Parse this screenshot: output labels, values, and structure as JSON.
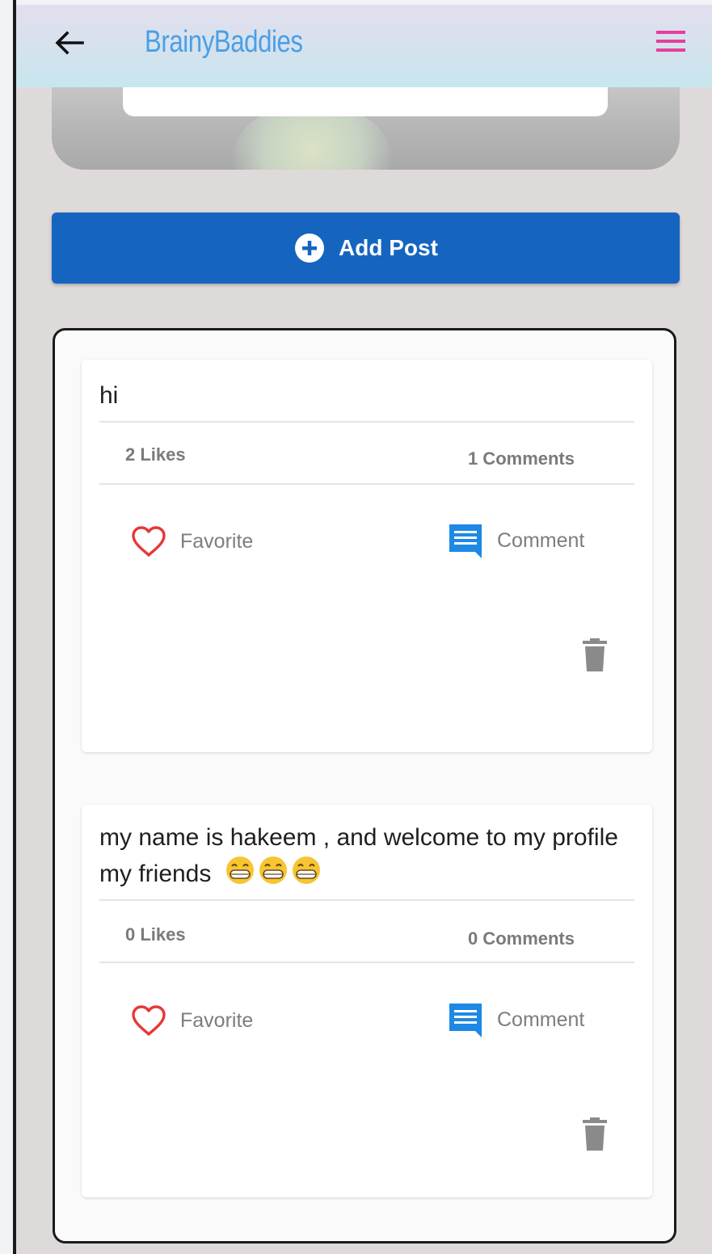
{
  "app": {
    "title": "BrainyBaddies",
    "title_color": "#4a9fe6",
    "menu_color": "#e53f9b"
  },
  "icons": {
    "back": "arrow-left-icon",
    "menu": "hamburger-menu-icon",
    "add": "plus-circle-icon",
    "favorite": "heart-outline-icon",
    "comment": "comment-bubble-icon",
    "delete": "trash-icon"
  },
  "add_post": {
    "label": "Add Post",
    "color": "#1565c0"
  },
  "posts": [
    {
      "text": "hi",
      "likes": "2 Likes",
      "comments": "1 Comments",
      "favorite_label": "Favorite",
      "comment_label": "Comment"
    },
    {
      "text": "my name is hakeem , and welcome to my profile my friends",
      "emoji": "😁😁😁",
      "likes": "0 Likes",
      "comments": "0 Comments",
      "favorite_label": "Favorite",
      "comment_label": "Comment"
    }
  ],
  "colors": {
    "favorite_icon": "#e53935",
    "comment_icon": "#1e88e5",
    "trash_icon": "#8a8a8a"
  }
}
